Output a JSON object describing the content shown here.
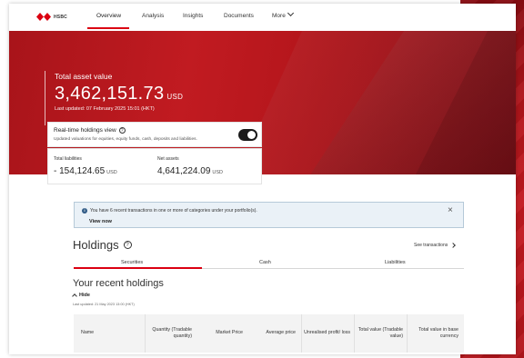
{
  "brand": {
    "name": "HSBC",
    "accent": "#db0011",
    "hero_red": "#b3151b"
  },
  "nav": {
    "items": [
      {
        "label": "Overview",
        "active": true
      },
      {
        "label": "Analysis",
        "active": false
      },
      {
        "label": "Insights",
        "active": false
      },
      {
        "label": "Documents",
        "active": false
      },
      {
        "label": "More",
        "active": false
      }
    ],
    "more_icon": "chevron-down-icon"
  },
  "hero": {
    "label": "Total asset value",
    "value": "3,462,151.73",
    "currency": "USD",
    "updated": "Last updated:  07 February 2025 15:01 (HKT)"
  },
  "realtime": {
    "title": "Real-time holdings view",
    "info_icon": "?",
    "subtitle": "Updated valuations for equities, equity funds, cash, deposits and liabilities.",
    "toggle_on": true
  },
  "summary": {
    "liabilities_label": "Total liabilities",
    "liabilities_value": "- 154,124.65",
    "liabilities_currency": "USD",
    "net_label": "Net assets",
    "net_value": "4,641,224.09",
    "net_currency": "USD"
  },
  "notice": {
    "icon": "i",
    "text": "You have 6 recent transactions in one or more of categories under your portfolio(s).",
    "link": "View now",
    "close": "×"
  },
  "holdings": {
    "title": "Holdings",
    "info_icon": "?",
    "see_transactions": "See transactions",
    "tabs": [
      {
        "label": "Securities",
        "active": true
      },
      {
        "label": "Cash",
        "active": false
      },
      {
        "label": "Liabilities",
        "active": false
      }
    ],
    "recent_title": "Your recent holdings",
    "hide_label": "Hide",
    "last_updated": "Last updated: 21 May 2023 13:00 (HKT)",
    "columns": [
      "Name",
      "Quantity (Tradable quantity)",
      "Market Price",
      "Average price",
      "Unrealised profit/ loss",
      "Total value (Tradable value)",
      "Total value in base currency"
    ]
  }
}
